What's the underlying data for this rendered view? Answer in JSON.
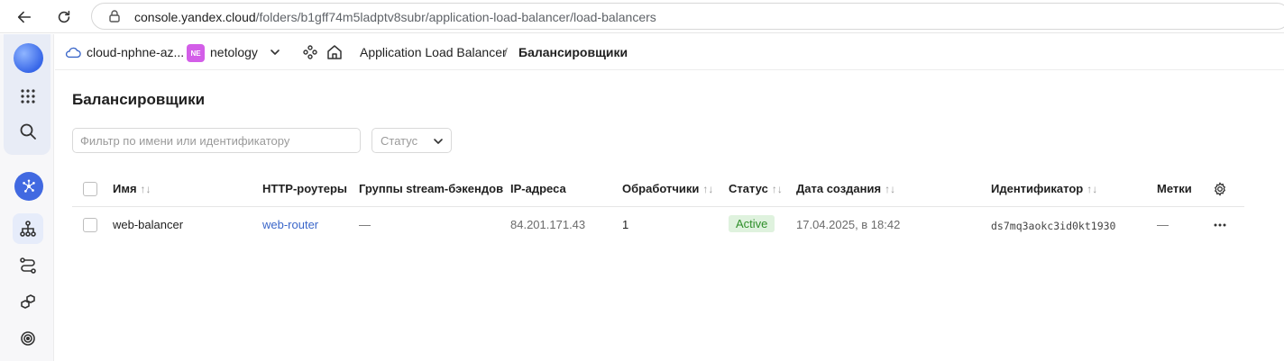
{
  "browser": {
    "url_host": "console.yandex.cloud",
    "url_path": "/folders/b1gff74m5ladptv8subr/application-load-balancer/load-balancers"
  },
  "header": {
    "cloud_name": "cloud-nphne-az...",
    "folder_badge": "NE",
    "folder_name": "netology",
    "service_crumb": "Application Load Balancer",
    "separator": "/",
    "current_crumb": "Балансировщики"
  },
  "page": {
    "title": "Балансировщики",
    "filter_placeholder": "Фильтр по имени или идентификатору",
    "status_label": "Статус"
  },
  "table": {
    "columns": {
      "name": "Имя",
      "http_routers": "HTTP-роутеры",
      "stream_groups": "Группы stream-бэкендов",
      "ip": "IP-адреса",
      "listeners": "Обработчики",
      "status": "Статус",
      "created": "Дата создания",
      "id": "Идентификатор",
      "labels": "Метки"
    },
    "sort_glyph": "↑↓",
    "rows": [
      {
        "name": "web-balancer",
        "http_router": "web-router",
        "stream_groups": "—",
        "ip": "84.201.171.43",
        "listeners": "1",
        "status": "Active",
        "created": "17.04.2025, в 18:42",
        "id": "ds7mq3aokc3id0kt1930",
        "labels": "—"
      }
    ]
  },
  "colors": {
    "accent": "#4169e1",
    "link": "#3a66c9",
    "status_active_bg": "#dff2de",
    "status_active_fg": "#2f8f2a",
    "folder_badge_bg": "#d35ee8"
  }
}
